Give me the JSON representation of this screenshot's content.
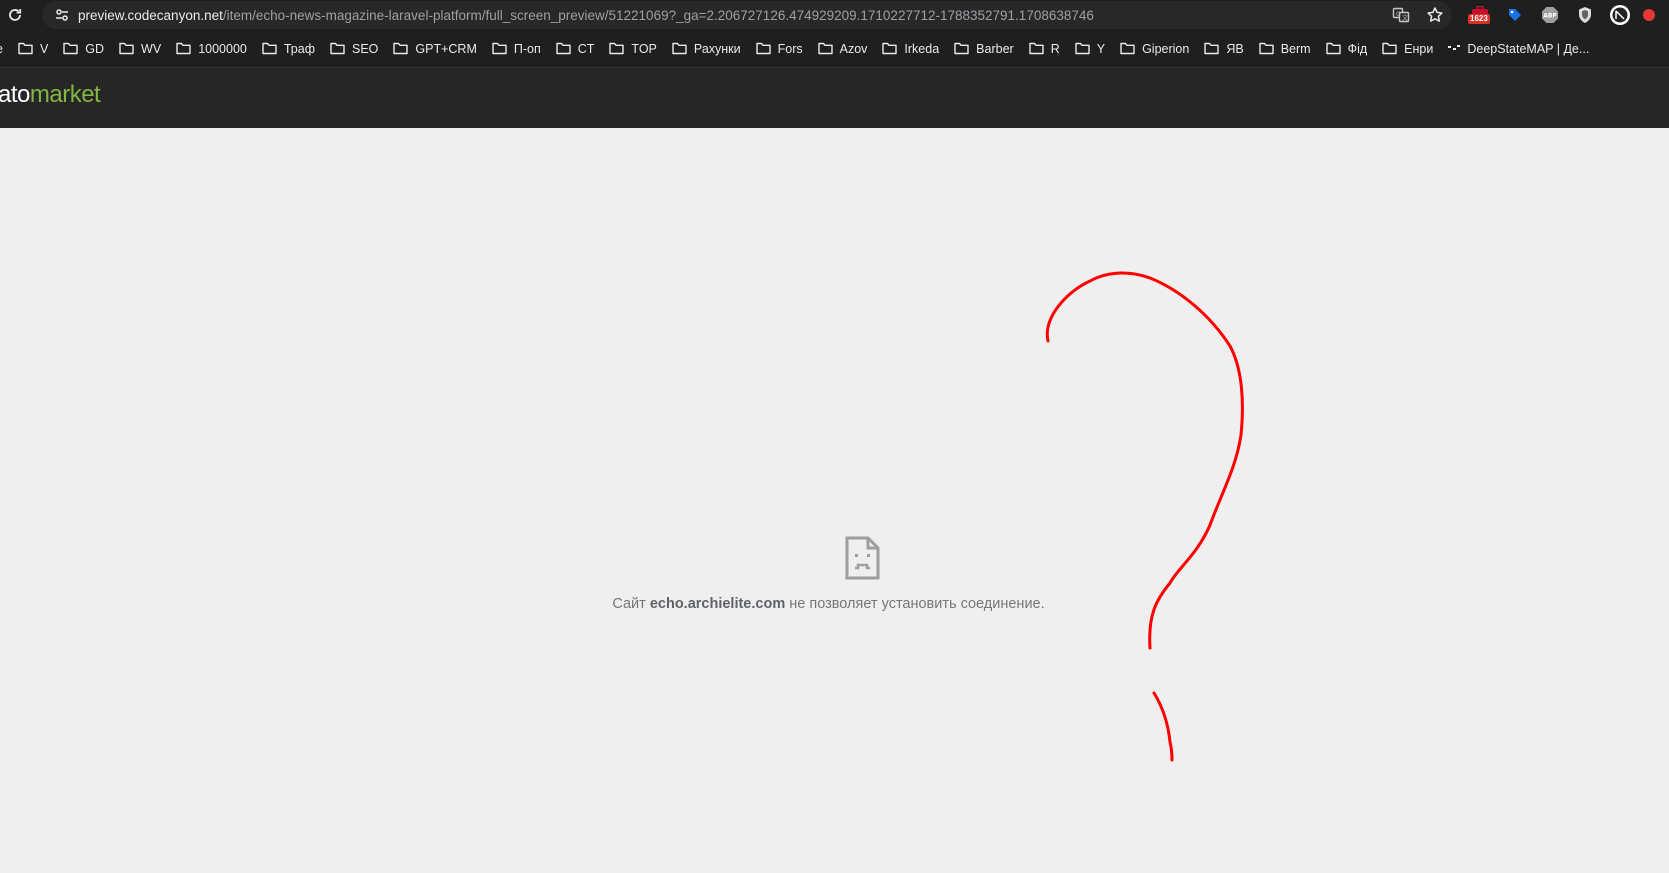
{
  "browser": {
    "url_host": "preview.codecanyon.net",
    "url_path": "/item/echo-news-magazine-laravel-platform/full_screen_preview/51221069?_ga=2.206727126.474929209.1710227712-1788352791.1708638746",
    "extensions": [
      {
        "name": "translate-icon"
      },
      {
        "name": "star-icon"
      },
      {
        "name": "extension-counter",
        "badge": "1623"
      },
      {
        "name": "tag-extension-icon"
      },
      {
        "name": "adblock-icon",
        "label": "ABP"
      },
      {
        "name": "shield-extension-icon"
      },
      {
        "name": "profile-avatar"
      }
    ]
  },
  "bookmarks": [
    {
      "label": "e",
      "type": "partial"
    },
    {
      "label": "V",
      "type": "folder"
    },
    {
      "label": "GD",
      "type": "folder"
    },
    {
      "label": "WV",
      "type": "folder"
    },
    {
      "label": "1000000",
      "type": "folder"
    },
    {
      "label": "Траф",
      "type": "folder"
    },
    {
      "label": "SEO",
      "type": "folder"
    },
    {
      "label": "GPT+CRM",
      "type": "folder"
    },
    {
      "label": "П-оп",
      "type": "folder"
    },
    {
      "label": "CT",
      "type": "folder"
    },
    {
      "label": "TOP",
      "type": "folder"
    },
    {
      "label": "Рахунки",
      "type": "folder"
    },
    {
      "label": "Fors",
      "type": "folder"
    },
    {
      "label": "Azov",
      "type": "folder"
    },
    {
      "label": "Irkeda",
      "type": "folder"
    },
    {
      "label": "Barber",
      "type": "folder"
    },
    {
      "label": "R",
      "type": "folder"
    },
    {
      "label": "Y",
      "type": "folder"
    },
    {
      "label": "Giperion",
      "type": "folder"
    },
    {
      "label": "ЯВ",
      "type": "folder"
    },
    {
      "label": "Berm",
      "type": "folder"
    },
    {
      "label": "Фід",
      "type": "folder"
    },
    {
      "label": "Енри",
      "type": "folder"
    },
    {
      "label": "DeepStateMAP | Де...",
      "type": "link"
    }
  ],
  "header": {
    "logo_part1": "ato",
    "logo_part2": "market"
  },
  "error": {
    "prefix": "Сайт",
    "host": "echo.archielite.com",
    "suffix": "не позволяет установить соединение."
  },
  "colors": {
    "chrome_bg": "#1f1f1f",
    "omnibox_bg": "#282828",
    "header_bg": "#262626",
    "page_bg": "#efefef",
    "logo_green": "#82b541",
    "scribble": "#ff0000"
  }
}
